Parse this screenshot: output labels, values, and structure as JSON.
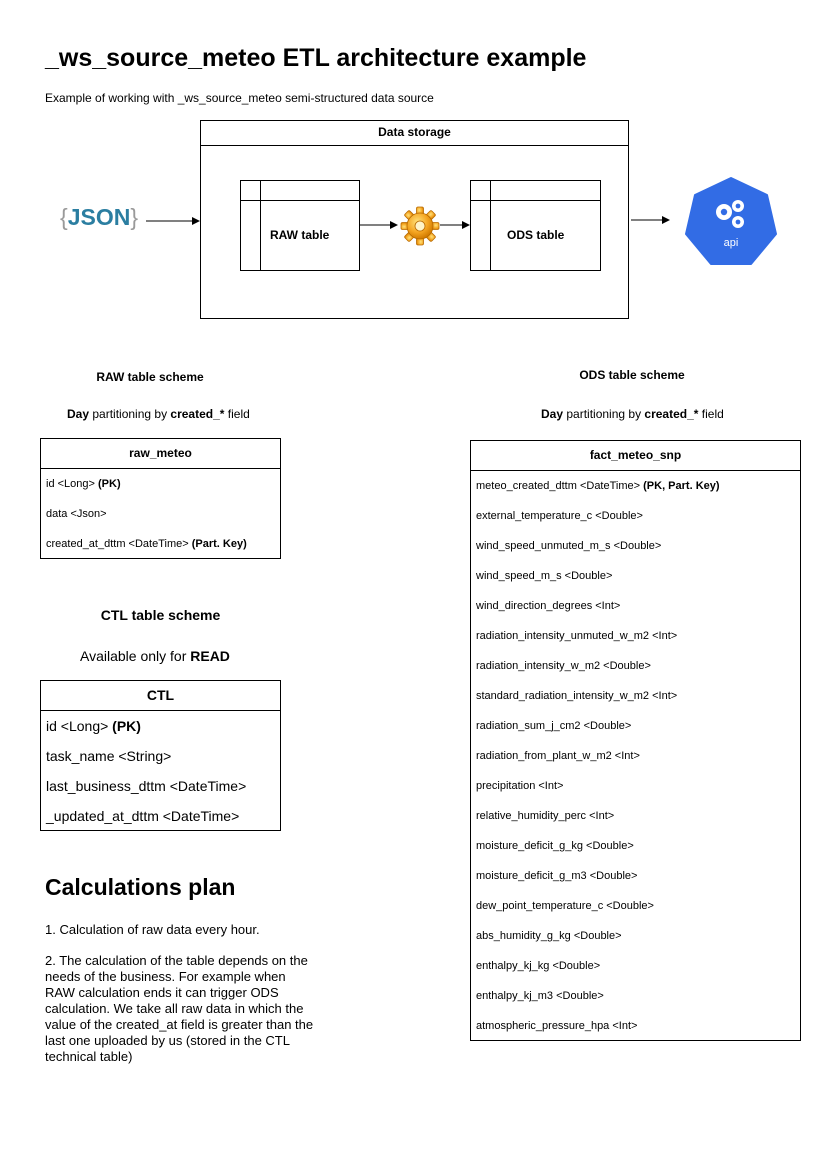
{
  "page": {
    "title": "_ws_source_meteo ETL architecture example",
    "subtitle": "Example of working with _ws_source_meteo semi-structured data source"
  },
  "architecture": {
    "storage_label": "Data storage",
    "source_left_brace": "{",
    "source_text": "JSON",
    "source_right_brace": "}",
    "raw_table_label": "RAW table",
    "ods_table_label": "ODS table",
    "api_label": "api",
    "icons": [
      "json-icon",
      "gear-icon",
      "kubernetes-api-icon"
    ],
    "colors": {
      "json_text": "#2b7ea1",
      "json_braces": "#9a9a9a",
      "gear": "#f5a623",
      "api_badge": "#326ce5"
    }
  },
  "raw_scheme": {
    "heading": "RAW table scheme",
    "partition_bold1": "Day",
    "partition_mid": " partitioning by ",
    "partition_bold2": "created_*",
    "partition_end": " field",
    "table_name": "raw_meteo",
    "rows": [
      {
        "text": "id <Long> ",
        "bold": "(PK)"
      },
      {
        "text": "data <Json>",
        "bold": ""
      },
      {
        "text": "created_at_dttm <DateTime> ",
        "bold": "(Part. Key)"
      }
    ]
  },
  "ods_scheme": {
    "heading": "ODS table scheme",
    "partition_bold1": "Day",
    "partition_mid": " partitioning by ",
    "partition_bold2": "created_*",
    "partition_end": " field",
    "table_name": "fact_meteo_snp",
    "rows": [
      {
        "text": "meteo_created_dttm <DateTime> ",
        "bold": "(PK, Part. Key)"
      },
      {
        "text": "external_temperature_c <Double>",
        "bold": ""
      },
      {
        "text": "wind_speed_unmuted_m_s <Double>",
        "bold": ""
      },
      {
        "text": "wind_speed_m_s <Double>",
        "bold": ""
      },
      {
        "text": "wind_direction_degrees <Int>",
        "bold": ""
      },
      {
        "text": "radiation_intensity_unmuted_w_m2 <Int>",
        "bold": ""
      },
      {
        "text": "radiation_intensity_w_m2 <Double>",
        "bold": ""
      },
      {
        "text": "standard_radiation_intensity_w_m2 <Int>",
        "bold": ""
      },
      {
        "text": "radiation_sum_j_cm2 <Double>",
        "bold": ""
      },
      {
        "text": "radiation_from_plant_w_m2 <Int>",
        "bold": ""
      },
      {
        "text": "precipitation <Int>",
        "bold": ""
      },
      {
        "text": "relative_humidity_perc <Int>",
        "bold": ""
      },
      {
        "text": "moisture_deficit_g_kg <Double>",
        "bold": ""
      },
      {
        "text": "moisture_deficit_g_m3 <Double>",
        "bold": ""
      },
      {
        "text": "dew_point_temperature_c <Double>",
        "bold": ""
      },
      {
        "text": "abs_humidity_g_kg <Double>",
        "bold": ""
      },
      {
        "text": "enthalpy_kj_kg <Double>",
        "bold": ""
      },
      {
        "text": "enthalpy_kj_m3 <Double>",
        "bold": ""
      },
      {
        "text": "atmospheric_pressure_hpa <Int>",
        "bold": ""
      }
    ]
  },
  "ctl_scheme": {
    "heading": "CTL table scheme",
    "access_text": "Available only for ",
    "access_bold": "READ",
    "table_name": "CTL",
    "rows": [
      {
        "text": "id <Long> ",
        "bold": "(PK)"
      },
      {
        "text": "task_name <String>",
        "bold": ""
      },
      {
        "text": "last_business_dttm <DateTime>",
        "bold": ""
      },
      {
        "text": "_updated_at_dttm <DateTime>",
        "bold": ""
      }
    ]
  },
  "calculations": {
    "title": "Calculations plan",
    "item1": "1. Calculation of raw data every hour.",
    "item2": "2. The calculation of the table depends on the needs of the business. For example when RAW calculation ends it can trigger ODS calculation. We take all raw data in which the value of the created_at field is greater than the last one uploaded by us (stored in the CTL technical table)"
  }
}
